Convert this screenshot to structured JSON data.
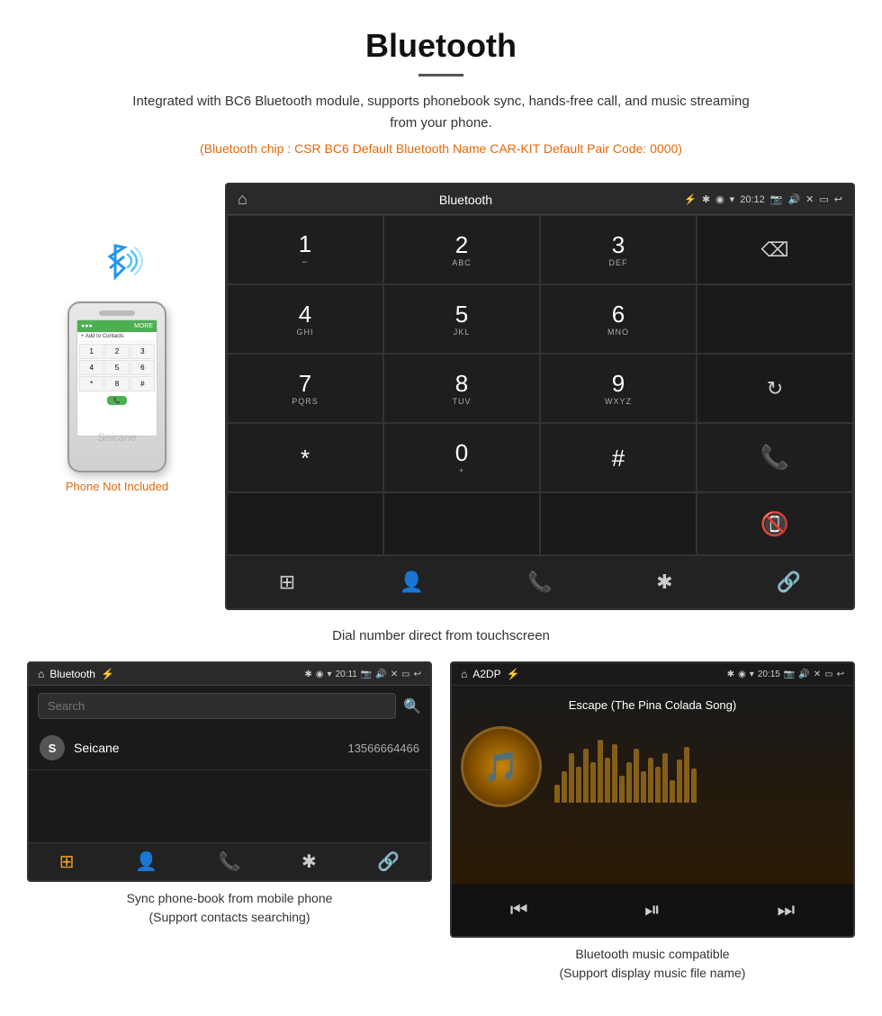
{
  "header": {
    "title": "Bluetooth",
    "description": "Integrated with BC6 Bluetooth module, supports phonebook sync, hands-free call, and music streaming from your phone.",
    "specs": "(Bluetooth chip : CSR BC6    Default Bluetooth Name CAR-KIT    Default Pair Code: 0000)"
  },
  "phone_not_included": "Phone Not Included",
  "dial_caption": "Dial number direct from touchscreen",
  "car_screen_title": "Bluetooth",
  "car_screen_time": "20:12",
  "dial_keys": [
    {
      "main": "1",
      "sub": "∽"
    },
    {
      "main": "2",
      "sub": "ABC"
    },
    {
      "main": "3",
      "sub": "DEF"
    },
    {
      "main": "",
      "sub": "",
      "type": "backspace"
    },
    {
      "main": "4",
      "sub": "GHI"
    },
    {
      "main": "5",
      "sub": "JKL"
    },
    {
      "main": "6",
      "sub": "MNO"
    },
    {
      "main": "",
      "sub": "",
      "type": "empty"
    },
    {
      "main": "7",
      "sub": "PQRS"
    },
    {
      "main": "8",
      "sub": "TUV"
    },
    {
      "main": "9",
      "sub": "WXYZ"
    },
    {
      "main": "",
      "sub": "",
      "type": "refresh"
    },
    {
      "main": "*",
      "sub": ""
    },
    {
      "main": "0",
      "sub": "+"
    },
    {
      "main": "#",
      "sub": ""
    },
    {
      "main": "",
      "sub": "",
      "type": "call"
    },
    {
      "main": "",
      "sub": "",
      "type": "endcall"
    }
  ],
  "phonebook_screen": {
    "title": "Bluetooth",
    "time": "20:11",
    "search_placeholder": "Search",
    "contacts": [
      {
        "initial": "S",
        "name": "Seicane",
        "number": "13566664466"
      }
    ]
  },
  "music_screen": {
    "title": "A2DP",
    "time": "20:15",
    "song": "Escape (The Pina Colada Song)",
    "album_icon": "🎵"
  },
  "bottom_captions": [
    {
      "line1": "Sync phone-book from mobile phone",
      "line2": "(Support contacts searching)"
    },
    {
      "line1": "Bluetooth music compatible",
      "line2": "(Support display music file name)"
    }
  ],
  "viz_heights": [
    20,
    35,
    55,
    40,
    60,
    45,
    70,
    50,
    65,
    30,
    45,
    60,
    35,
    50,
    40,
    55,
    25,
    48,
    62,
    38
  ]
}
